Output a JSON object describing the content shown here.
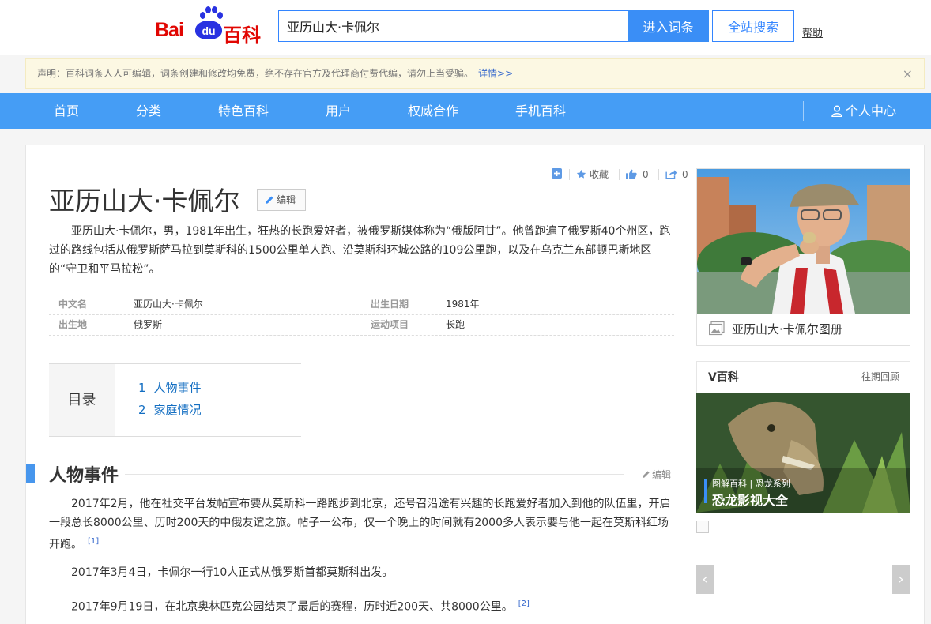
{
  "header": {
    "logo_bai": "Bai",
    "logo_du": "du",
    "logo_baike": "百科",
    "search_value": "亚历山大·卡佩尔",
    "btn_enter": "进入词条",
    "btn_all": "全站搜索",
    "help": "帮助"
  },
  "notice": {
    "text": "声明：百科词条人人可编辑，词条创建和修改均免费，绝不存在官方及代理商付费代编，请勿上当受骗。",
    "more": "详情>>",
    "close": "×"
  },
  "nav": {
    "items": [
      "首页",
      "分类",
      "特色百科",
      "用户",
      "权威合作",
      "手机百科"
    ],
    "user": "个人中心"
  },
  "tools": {
    "collect": "收藏",
    "like_count": "0",
    "share_count": "0"
  },
  "title": "亚历山大·卡佩尔",
  "edit_label": "编辑",
  "summary": "亚历山大·卡佩尔，男，1981年出生，狂热的长跑爱好者，被俄罗斯媒体称为“俄版阿甘”。他曾跑遍了俄罗斯40个州区，跑过的路线包括从俄罗斯萨马拉到莫斯科的1500公里单人跑、沿莫斯科环城公路的109公里跑，以及在乌克兰东部顿巴斯地区的“守卫和平马拉松”。",
  "basic_info": [
    {
      "k1": "中文名",
      "v1": "亚历山大·卡佩尔",
      "k2": "出生日期",
      "v2": "1981年"
    },
    {
      "k1": "出生地",
      "v1": "俄罗斯",
      "k2": "运动项目",
      "v2": "长跑"
    }
  ],
  "catalog": {
    "label": "目录",
    "items": [
      {
        "num": "1",
        "text": "人物事件"
      },
      {
        "num": "2",
        "text": "家庭情况"
      }
    ]
  },
  "section1": {
    "title": "人物事件",
    "edit": "编辑",
    "paras": [
      {
        "text": "2017年2月，他在社交平台发帖宣布要从莫斯科一路跑步到北京，还号召沿途有兴趣的长跑爱好者加入到他的队伍里，开启一段总长8000公里、历时200天的中俄友谊之旅。帖子一公布，仅一个晚上的时间就有2000多人表示要与他一起在莫斯科红场开跑。",
        "ref": "[1]"
      },
      {
        "text": "2017年3月4日，卡佩尔一行10人正式从俄罗斯首都莫斯科出发。",
        "ref": ""
      },
      {
        "text": "2017年9月19日，在北京奥林匹克公园结束了最后的赛程，历时近200天、共8000公里。",
        "ref": "[2]"
      }
    ]
  },
  "sidebar": {
    "album_caption": "亚历山大·卡佩尔图册",
    "v_title": "V百科",
    "v_more": "往期回顾",
    "v_tag": "图解百科 | 恐龙系列",
    "v_video_title": "恐龙影视大全",
    "arrow_left": "‹",
    "arrow_right": "›"
  },
  "colors": {
    "brand_blue": "#459df5",
    "logo_red": "#e10602",
    "link": "#136ec2"
  }
}
